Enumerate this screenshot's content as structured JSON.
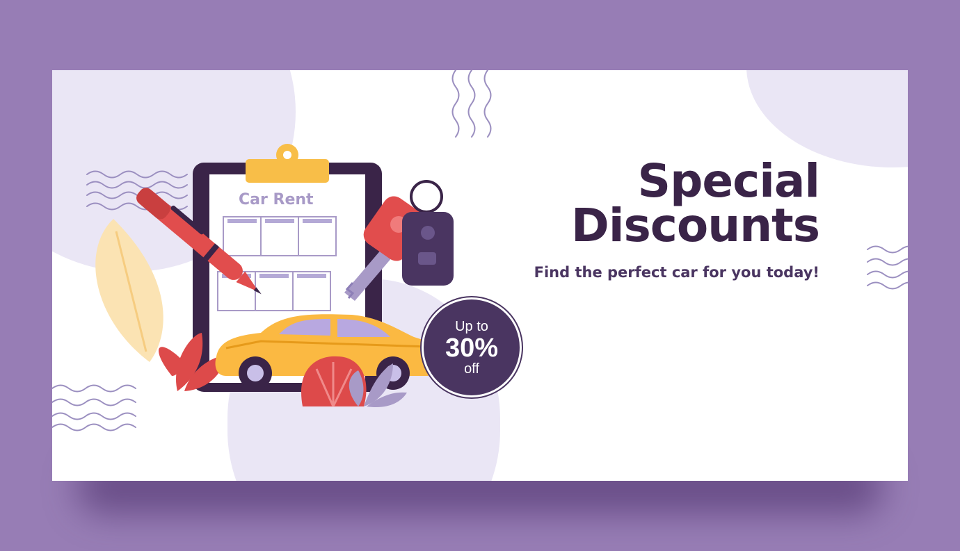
{
  "banner": {
    "headline_line1": "Special",
    "headline_line2": "Discounts",
    "tagline": "Find the perfect car for you today!",
    "clipboard_title": "Car Rent",
    "badge": {
      "line1": "Up to",
      "line2": "30%",
      "line3": "off"
    }
  },
  "colors": {
    "frame": "#977db5",
    "headline": "#3a2448",
    "badge": "#4a3561",
    "car": "#fbb942",
    "pen": "#e14d4d",
    "blob": "#eae6f5"
  },
  "icons": [
    "clipboard-icon",
    "pen-icon",
    "car-key-icon",
    "key-fob-icon",
    "car-icon",
    "leaf-icon",
    "wave-pattern-icon"
  ]
}
